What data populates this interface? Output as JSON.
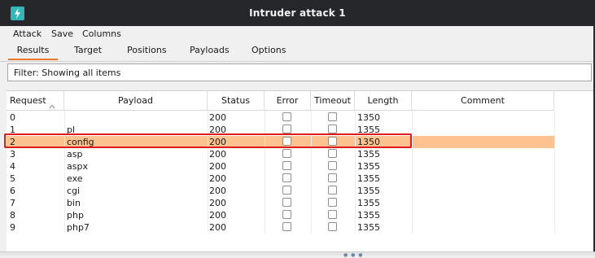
{
  "window": {
    "title": "Intruder attack 1"
  },
  "menu": [
    "Attack",
    "Save",
    "Columns"
  ],
  "tabs": [
    {
      "label": "Results",
      "active": true
    },
    {
      "label": "Target",
      "active": false
    },
    {
      "label": "Positions",
      "active": false
    },
    {
      "label": "Payloads",
      "active": false
    },
    {
      "label": "Options",
      "active": false
    }
  ],
  "filter": {
    "text": "Filter: Showing all items"
  },
  "table": {
    "columns": [
      "Request",
      "Payload",
      "Status",
      "Error",
      "Timeout",
      "Length",
      "Comment"
    ],
    "sort": {
      "column": "Request",
      "direction": "ascending"
    },
    "selected_request": "2",
    "rows": [
      {
        "request": "0",
        "payload": "",
        "status": "200",
        "error": false,
        "timeout": false,
        "length": "1350",
        "comment": ""
      },
      {
        "request": "1",
        "payload": "pl",
        "status": "200",
        "error": false,
        "timeout": false,
        "length": "1355",
        "comment": ""
      },
      {
        "request": "2",
        "payload": "config",
        "status": "200",
        "error": false,
        "timeout": false,
        "length": "1350",
        "comment": ""
      },
      {
        "request": "3",
        "payload": "asp",
        "status": "200",
        "error": false,
        "timeout": false,
        "length": "1355",
        "comment": ""
      },
      {
        "request": "4",
        "payload": "aspx",
        "status": "200",
        "error": false,
        "timeout": false,
        "length": "1355",
        "comment": ""
      },
      {
        "request": "5",
        "payload": "exe",
        "status": "200",
        "error": false,
        "timeout": false,
        "length": "1355",
        "comment": ""
      },
      {
        "request": "6",
        "payload": "cgi",
        "status": "200",
        "error": false,
        "timeout": false,
        "length": "1355",
        "comment": ""
      },
      {
        "request": "7",
        "payload": "bin",
        "status": "200",
        "error": false,
        "timeout": false,
        "length": "1355",
        "comment": ""
      },
      {
        "request": "8",
        "payload": "php",
        "status": "200",
        "error": false,
        "timeout": false,
        "length": "1355",
        "comment": ""
      },
      {
        "request": "9",
        "payload": "php7",
        "status": "200",
        "error": false,
        "timeout": false,
        "length": "1355",
        "comment": ""
      }
    ]
  },
  "colors": {
    "titlebar": "#26272b",
    "accent": "#e8772e",
    "selected_row": "#fcc28f",
    "annotation_box": "#e01b1b",
    "app_icon": "#31b7b9"
  },
  "icons": {
    "app": "lightning-bolt-icon",
    "sort": "chevron-up-icon"
  }
}
